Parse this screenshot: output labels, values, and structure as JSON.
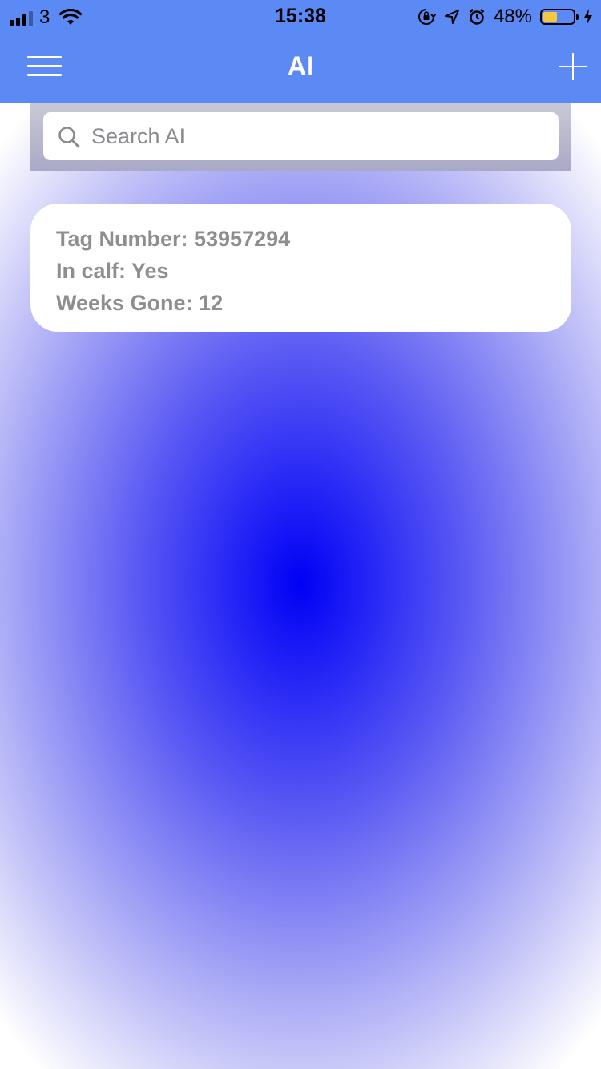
{
  "status_bar": {
    "carrier": "3",
    "time": "15:38",
    "battery_percent_label": "48%",
    "battery_level": 0.48,
    "icons": [
      "signal-icon",
      "wifi-icon",
      "orientation-lock-icon",
      "location-icon",
      "alarm-icon",
      "battery-icon",
      "charging-icon"
    ]
  },
  "header": {
    "title": "AI",
    "menu_icon": "hamburger-menu-icon",
    "add_icon": "plus-icon"
  },
  "search": {
    "placeholder": "Search AI",
    "value": ""
  },
  "records": [
    {
      "tag_line": "Tag Number: 53957294",
      "in_calf_line": "In calf: Yes",
      "weeks_line": "Weeks Gone: 12"
    }
  ],
  "colors": {
    "header_bg": "#5b8af5",
    "accent": "#0000f5",
    "card_text": "#8e8e8e"
  }
}
